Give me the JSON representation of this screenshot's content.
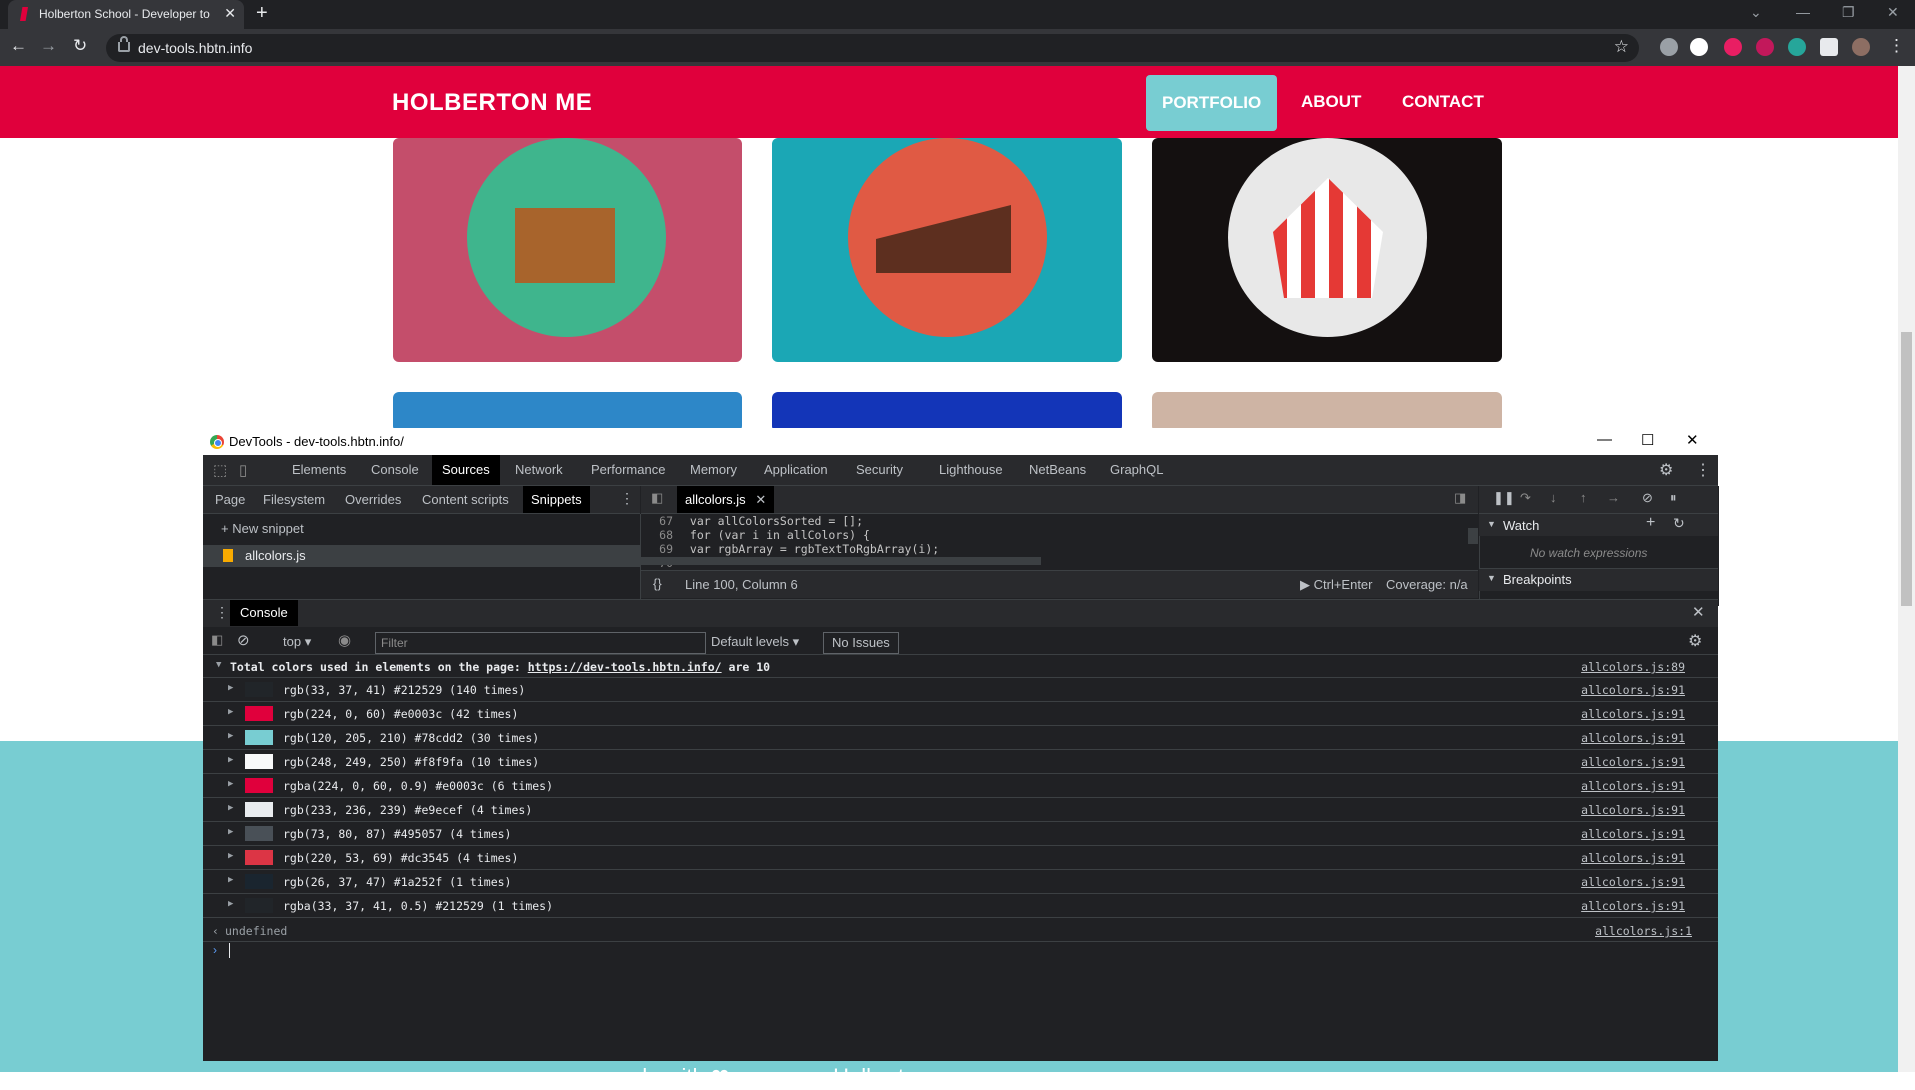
{
  "browser": {
    "tab_title": "Holberton School - Developer to",
    "tab_close": "✕",
    "new_tab": "+",
    "url": "dev-tools.hbtn.info"
  },
  "page": {
    "brand": "HOLBERTON ME",
    "nav": [
      "PORTFOLIO",
      "ABOUT",
      "CONTACT"
    ],
    "footer_text": "... made with ❤ ... ... ... ... Holberton ... ..."
  },
  "devtools": {
    "window_title": "DevTools - dev-tools.hbtn.info/",
    "main_tabs": [
      "Elements",
      "Console",
      "Sources",
      "Network",
      "Performance",
      "Memory",
      "Application",
      "Security",
      "Lighthouse",
      "NetBeans",
      "GraphQL"
    ],
    "active_main_tab": "Sources",
    "sub_tabs": [
      "Page",
      "Filesystem",
      "Overrides",
      "Content scripts",
      "Snippets"
    ],
    "active_sub_tab": "Snippets",
    "new_snippet": "+ New snippet",
    "snippet_file": "allcolors.js",
    "editor_tab": "allcolors.js",
    "code_lines": [
      {
        "num": "67",
        "text": "  var allColorsSorted = [];"
      },
      {
        "num": "68",
        "text": "  for (var i in allColors) {"
      },
      {
        "num": "69",
        "text": "    var rgbArray = rgbTextToRgbArray(i);"
      },
      {
        "num": "70",
        "text": ""
      }
    ],
    "status": "Line 100, Column 6",
    "run_hint": "▶ Ctrl+Enter",
    "coverage": "Coverage: n/a",
    "watch_title": "Watch",
    "watch_empty": "No watch expressions",
    "breakpoints_title": "Breakpoints",
    "drawer_tab": "Console",
    "context": "top",
    "filter_placeholder": "Filter",
    "levels": "Default levels ▾",
    "issues": "No Issues",
    "log_header": {
      "prefix": "Total colors used in elements on the page: ",
      "link": "https://dev-tools.hbtn.info/",
      "suffix": " are 10",
      "source": "allcolors.js:89"
    },
    "logs": [
      {
        "text": "rgb(33, 37, 41) #212529 (140 times)",
        "color": "#212529",
        "source": "allcolors.js:91"
      },
      {
        "text": "rgb(224, 0, 60) #e0003c (42 times)",
        "color": "#e0003c",
        "source": "allcolors.js:91"
      },
      {
        "text": "rgb(120, 205, 210) #78cdd2 (30 times)",
        "color": "#78cdd2",
        "source": "allcolors.js:91"
      },
      {
        "text": "rgb(248, 249, 250) #f8f9fa (10 times)",
        "color": "#f8f9fa",
        "source": "allcolors.js:91"
      },
      {
        "text": "rgba(224, 0, 60, 0.9) #e0003c (6 times)",
        "color": "#e0003c",
        "source": "allcolors.js:91"
      },
      {
        "text": "rgb(233, 236, 239) #e9ecef (4 times)",
        "color": "#e9ecef",
        "source": "allcolors.js:91"
      },
      {
        "text": "rgb(73, 80, 87) #495057 (4 times)",
        "color": "#495057",
        "source": "allcolors.js:91"
      },
      {
        "text": "rgb(220, 53, 69) #dc3545 (4 times)",
        "color": "#dc3545",
        "source": "allcolors.js:91"
      },
      {
        "text": "rgb(26, 37, 47) #1a252f (1 times)",
        "color": "#1a252f",
        "source": "allcolors.js:91"
      },
      {
        "text": "rgba(33, 37, 41, 0.5) #212529 (1 times)",
        "color": "#212529",
        "source": "allcolors.js:91"
      }
    ],
    "result": "undefined",
    "result_source": "allcolors.js:1"
  },
  "colors": {
    "accent": "#e0003c",
    "teal": "#78cdd2",
    "devtools_bg": "#202124"
  }
}
